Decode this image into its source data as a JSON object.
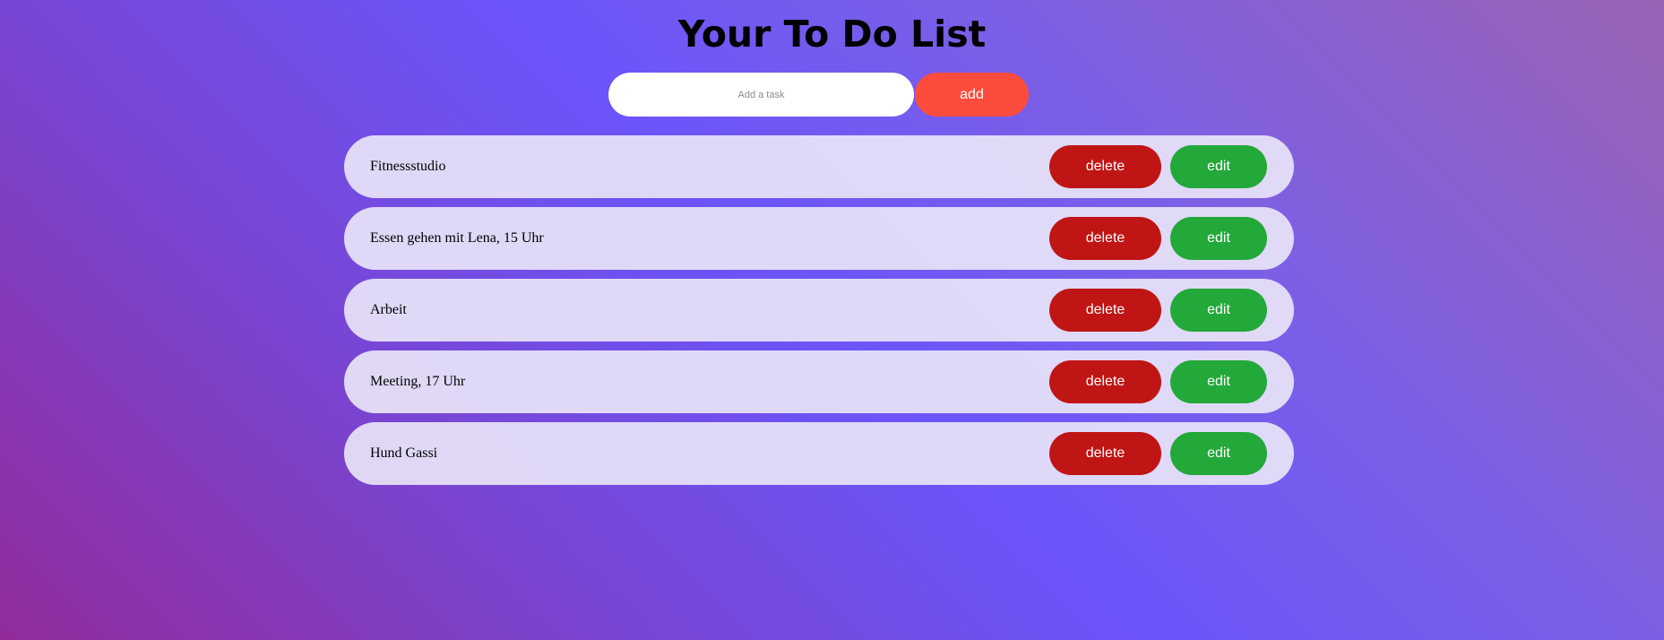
{
  "header": {
    "title": "Your To Do List"
  },
  "add_form": {
    "input_value": "",
    "input_placeholder": "Add a task",
    "add_label": "add"
  },
  "tasks": [
    {
      "text": "Fitnessstudio",
      "delete_label": "delete",
      "edit_label": "edit"
    },
    {
      "text": "Essen gehen mit Lena, 15 Uhr",
      "delete_label": "delete",
      "edit_label": "edit"
    },
    {
      "text": "Arbeit",
      "delete_label": "delete",
      "edit_label": "edit"
    },
    {
      "text": "Meeting, 17 Uhr",
      "delete_label": "delete",
      "edit_label": "edit"
    },
    {
      "text": "Hund Gassi",
      "delete_label": "delete",
      "edit_label": "edit"
    }
  ],
  "colors": {
    "add_button": "#fd4c3c",
    "delete_button": "#c01515",
    "edit_button": "#23a83a",
    "task_background": "#ebe8f8",
    "background_accent": "#6b55fb"
  }
}
